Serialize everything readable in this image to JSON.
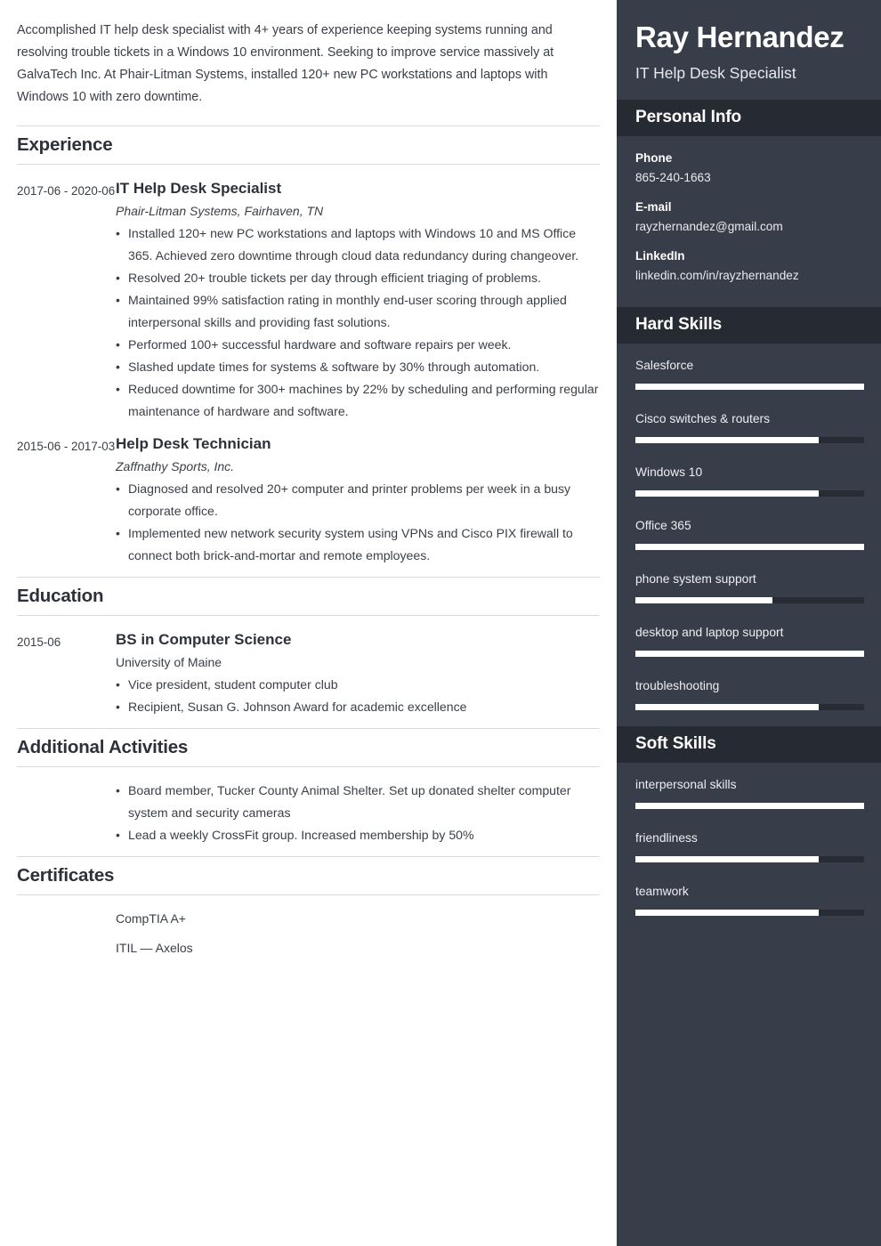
{
  "main": {
    "summary": "Accomplished IT help desk specialist with 4+ years of experience keeping systems running and resolving trouble tickets in a Windows 10 environment. Seeking to improve service massively at GalvaTech Inc. At Phair-Litman Systems, installed 120+ new PC workstations and laptops with Windows 10 with zero downtime.",
    "sections": {
      "experience": {
        "title": "Experience",
        "entries": [
          {
            "date": "2017-06 - 2020-06",
            "title": "IT Help Desk Specialist",
            "subtitle": "Phair-Litman Systems, Fairhaven, TN",
            "bullets": [
              "Installed 120+ new PC workstations and laptops with Windows 10 and MS Office 365. Achieved zero downtime through cloud data redundancy during changeover.",
              "Resolved 20+ trouble tickets per day through efficient triaging of problems.",
              "Maintained 99% satisfaction rating in monthly end-user scoring through applied interpersonal skills and providing fast solutions.",
              "Performed 100+ successful hardware and software repairs per week.",
              "Slashed update times for systems & software by 30% through automation.",
              "Reduced downtime for 300+ machines by 22% by scheduling and performing regular maintenance of hardware and software."
            ]
          },
          {
            "date": "2015-06 - 2017-03",
            "title": "Help Desk Technician",
            "subtitle": "Zaffnathy Sports, Inc.",
            "bullets": [
              "Diagnosed and resolved 20+ computer and printer problems per week in a busy corporate office.",
              "Implemented new network security system using VPNs and Cisco PIX firewall to connect both brick-and-mortar and remote employees."
            ]
          }
        ]
      },
      "education": {
        "title": "Education",
        "entries": [
          {
            "date": "2015-06",
            "title": "BS in Computer Science",
            "subtitle": "University of Maine",
            "bullets": [
              "Vice president, student computer club",
              "Recipient, Susan G. Johnson Award for academic excellence"
            ]
          }
        ]
      },
      "activities": {
        "title": "Additional Activities",
        "bullets": [
          "Board member, Tucker County Animal Shelter. Set up donated shelter computer system and security cameras",
          "Lead a weekly CrossFit group. Increased membership by 50%"
        ]
      },
      "certificates": {
        "title": "Certificates",
        "items": [
          "CompTIA A+",
          "ITIL — Axelos"
        ]
      }
    }
  },
  "sidebar": {
    "name": "Ray Hernandez",
    "role": "IT Help Desk Specialist",
    "personal_info": {
      "title": "Personal Info",
      "items": [
        {
          "label": "Phone",
          "value": "865-240-1663"
        },
        {
          "label": "E-mail",
          "value": "rayzhernandez@gmail.com"
        },
        {
          "label": "LinkedIn",
          "value": "linkedin.com/in/rayzhernandez"
        }
      ]
    },
    "hard_skills": {
      "title": "Hard Skills",
      "items": [
        {
          "label": "Salesforce",
          "level": 100
        },
        {
          "label": "Cisco switches & routers",
          "level": 80
        },
        {
          "label": "Windows 10",
          "level": 80
        },
        {
          "label": "Office 365",
          "level": 100
        },
        {
          "label": "phone system support",
          "level": 60
        },
        {
          "label": "desktop and laptop support",
          "level": 100
        },
        {
          "label": "troubleshooting",
          "level": 80
        }
      ]
    },
    "soft_skills": {
      "title": "Soft Skills",
      "items": [
        {
          "label": "interpersonal skills",
          "level": 100
        },
        {
          "label": "friendliness",
          "level": 80
        },
        {
          "label": "teamwork",
          "level": 80
        }
      ]
    }
  },
  "colors": {
    "sidebar_bg": "#373d49",
    "sidebar_band_bg": "#262a33",
    "bar_fill": "#ffffff",
    "bar_track": "#272b34",
    "heading": "#2c313a",
    "body_text": "#3a3f46",
    "rule": "#d8dade"
  }
}
